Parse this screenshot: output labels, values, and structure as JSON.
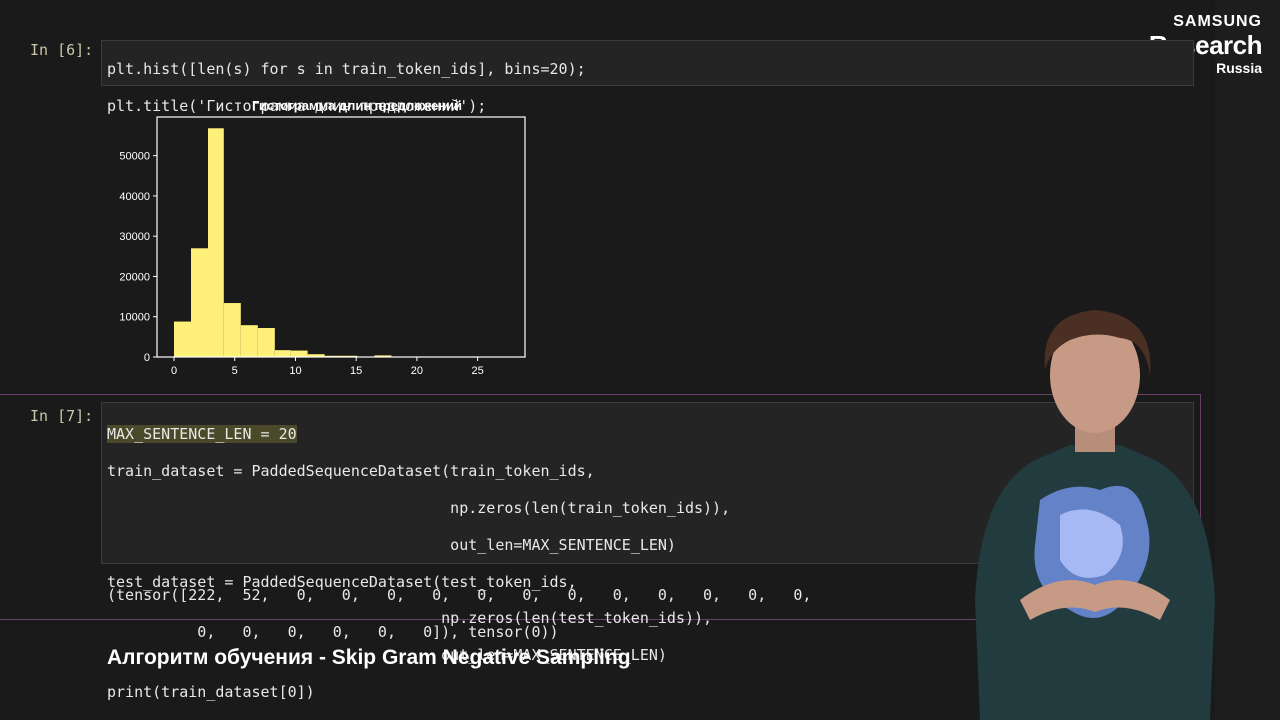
{
  "logo": {
    "line1": "SAMSUNG",
    "line2": "Research",
    "line3": "Russia"
  },
  "cell6": {
    "prompt": "In [6]:",
    "lines": [
      "plt.hist([len(s) for s in train_token_ids], bins=20);",
      "plt.title('Гистограмма длин предложений');"
    ]
  },
  "chart_data": {
    "type": "bar",
    "title": "Гистограмма длин предложений",
    "bins": [
      {
        "x0": 0,
        "x1": 1.4,
        "value": 8800
      },
      {
        "x0": 1.4,
        "x1": 2.8,
        "value": 27000
      },
      {
        "x0": 2.8,
        "x1": 4.1,
        "value": 56800
      },
      {
        "x0": 4.1,
        "x1": 5.5,
        "value": 13400
      },
      {
        "x0": 5.5,
        "x1": 6.9,
        "value": 7900
      },
      {
        "x0": 6.9,
        "x1": 8.3,
        "value": 7200
      },
      {
        "x0": 8.3,
        "x1": 9.6,
        "value": 1700
      },
      {
        "x0": 9.6,
        "x1": 11.0,
        "value": 1600
      },
      {
        "x0": 11.0,
        "x1": 12.4,
        "value": 700
      },
      {
        "x0": 12.4,
        "x1": 13.8,
        "value": 300
      },
      {
        "x0": 13.8,
        "x1": 15.1,
        "value": 300
      },
      {
        "x0": 15.1,
        "x1": 16.5,
        "value": 100
      },
      {
        "x0": 16.5,
        "x1": 17.9,
        "value": 400
      },
      {
        "x0": 17.9,
        "x1": 19.3,
        "value": 80
      },
      {
        "x0": 19.3,
        "x1": 20.6,
        "value": 50
      },
      {
        "x0": 20.6,
        "x1": 22.0,
        "value": 30
      },
      {
        "x0": 22.0,
        "x1": 23.4,
        "value": 20
      },
      {
        "x0": 23.4,
        "x1": 24.8,
        "value": 10
      },
      {
        "x0": 24.8,
        "x1": 26.1,
        "value": 5
      },
      {
        "x0": 26.1,
        "x1": 27.5,
        "value": 5
      }
    ],
    "xlim": [
      -1.4,
      28.9
    ],
    "ylim": [
      0,
      59600
    ],
    "xticks": [
      0,
      5,
      10,
      15,
      20,
      25
    ],
    "yticks": [
      0,
      10000,
      20000,
      30000,
      40000,
      50000
    ],
    "bar_color": "#fff07a"
  },
  "cell7": {
    "prompt": "In [7]:",
    "lines": [
      "MAX_SENTENCE_LEN = 20",
      "train_dataset = PaddedSequenceDataset(train_token_ids,",
      "                                      np.zeros(len(train_token_ids)),",
      "                                      out_len=MAX_SENTENCE_LEN)",
      "test_dataset = PaddedSequenceDataset(test_token_ids,",
      "                                     np.zeros(len(test_token_ids)),",
      "                                     out_len=MAX_SENTENCE_LEN)",
      "print(train_dataset[0])"
    ],
    "output": [
      "(tensor([222,  52,   0,   0,   0,   0,   0,   0,   0,   0,   0,   0,   0,   0,",
      "          0,   0,   0,   0,   0,   0]), tensor(0))"
    ]
  },
  "heading": "Алгоритм обучения - Skip Gram Negative Sampling",
  "colors": {
    "background": "#1a1a1a",
    "bars": "#fff07a",
    "cell_border": "#6b3f6b"
  }
}
